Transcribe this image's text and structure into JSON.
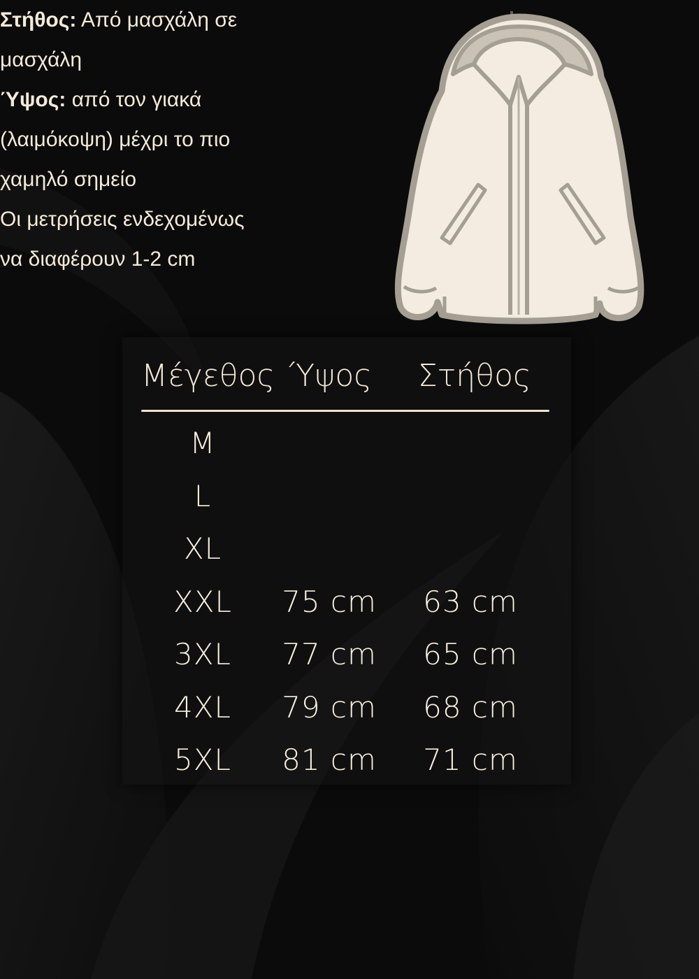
{
  "intro": {
    "chest_label": "Στήθος:",
    "chest_text_1": "Από μασχάλη σε",
    "chest_text_2": "μασχάλη",
    "height_label": "Ύψος:",
    "height_text_1": "από τον γιακά",
    "height_text_2": "(λαιμόκοψη) μέχρι το πιο",
    "height_text_3": "χαμηλό σημείο",
    "note_1": "Οι μετρήσεις ενδεχομένως",
    "note_2": "να διαφέρουν 1-2 cm"
  },
  "illustration": {
    "icon": "jacket-icon",
    "colors": {
      "fill": "#f4ece1",
      "outline": "#a59e93",
      "lining": "#c9c2b5"
    }
  },
  "table": {
    "headers": [
      "Μέγεθος",
      "Ύψος",
      "Στήθος"
    ],
    "rows": [
      {
        "size": "M",
        "height": "",
        "chest": ""
      },
      {
        "size": "L",
        "height": "",
        "chest": ""
      },
      {
        "size": "XL",
        "height": "",
        "chest": ""
      },
      {
        "size": "XXL",
        "height": "75 cm",
        "chest": "63 cm"
      },
      {
        "size": "3XL",
        "height": "77 cm",
        "chest": "65 cm"
      },
      {
        "size": "4XL",
        "height": "79 cm",
        "chest": "68 cm"
      },
      {
        "size": "5XL",
        "height": "81 cm",
        "chest": "71 cm"
      }
    ]
  },
  "colors": {
    "background": "#0b0b0b",
    "text": "#f4ead8"
  }
}
